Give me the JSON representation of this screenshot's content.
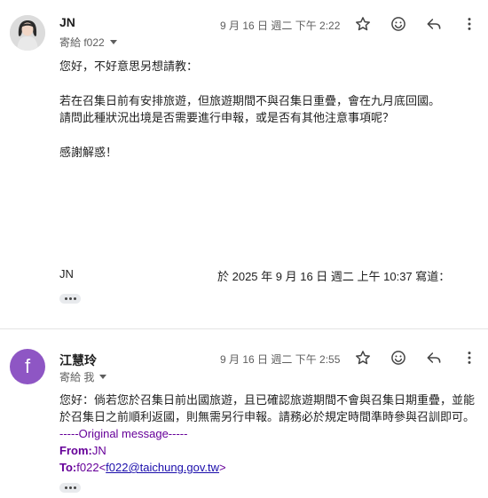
{
  "message1": {
    "sender": "JN",
    "to_label": "寄給 f022",
    "date": "9 月 16 日 週二 下午 2:22",
    "body": {
      "line1": "您好，不好意思另想請教：",
      "line2": "若在召集日前有安排旅遊，但旅遊期間不與召集日重疊，會在九月底回國。",
      "line3": "請問此種狀況出境是否需要進行申報，或是否有其他注意事項呢？",
      "line4": "感謝解惑！"
    },
    "quote_header_name": "JN",
    "quote_header_date": "於 2025 年 9 月 16 日 週二 上午 10:37 寫道："
  },
  "message2": {
    "avatar_letter": "f",
    "sender": "江慧玲",
    "to_label": "寄給 我",
    "date": "9 月 16 日 週二 下午 2:55",
    "body": {
      "line1": "您好：倘若您於召集日前出國旅遊，且已確認旅遊期間不會與召集日期重疊，並能",
      "line2": "於召集日之前順利返國，則無需另行申報。請務必於規定時間準時參與召訓即可。"
    },
    "original_marker": "-----Original message-----",
    "from_label": "From:",
    "from_value": "JN",
    "to_field_label": "To:",
    "to_field_name": "f022",
    "to_field_email": "f022@taichung.gov.tw"
  },
  "icons": [
    "star-icon",
    "emoji-icon",
    "reply-icon",
    "more-vert-icon"
  ],
  "colors": {
    "avatar2_bg": "#8e56c4",
    "link": "#1a0dab",
    "quote_purple": "#660099"
  }
}
